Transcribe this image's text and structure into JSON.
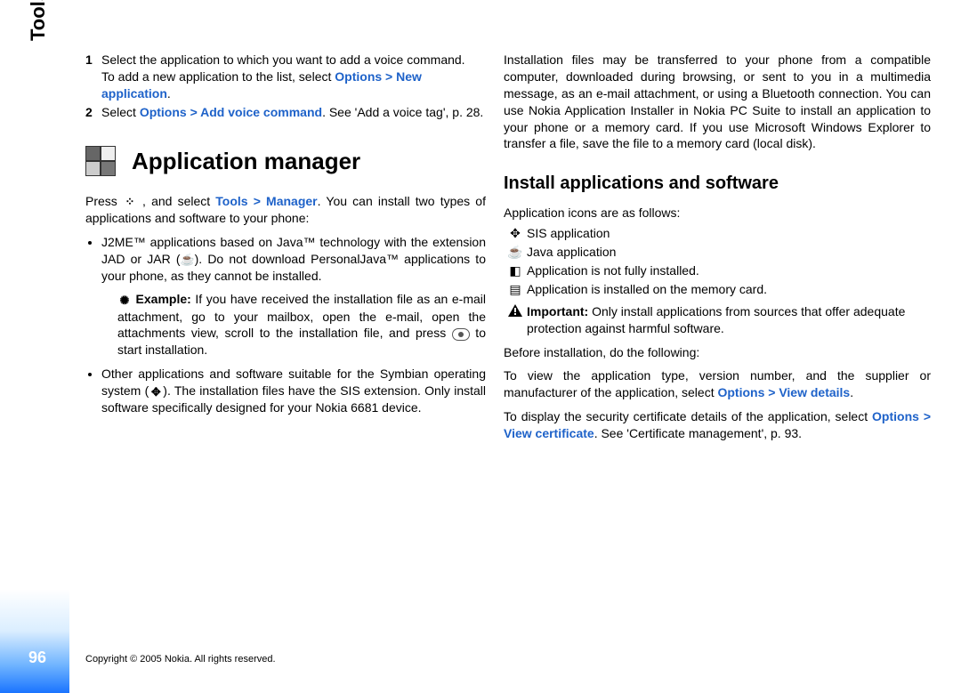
{
  "sideTab": "Tools",
  "pageNumber": "96",
  "copyright": "Copyright © 2005 Nokia. All rights reserved.",
  "step1": {
    "num": "1",
    "text": "Select the application to which you want to add a voice command.",
    "hint_pre": "To add a new application to the list, select ",
    "link1": "Options",
    "gt": " > ",
    "link2": "New application",
    "period": "."
  },
  "step2": {
    "num": "2",
    "pre": "Select ",
    "link1": "Options",
    "gt": " > ",
    "link2": "Add voice command",
    "post": ". See 'Add a voice tag', p. 28."
  },
  "headingMain": "Application manager",
  "press": {
    "pre": "Press ",
    "mid": " , and select ",
    "link1": "Tools",
    "gt": " > ",
    "link2": "Manager",
    "post": ". You can install two types of applications and software to your phone:"
  },
  "bullet1": {
    "pre": "J2ME™ applications based on Java™ technology with the extension JAD or JAR (",
    "post": "). Do not download PersonalJava™ applications to your phone, as they cannot be installed."
  },
  "example": {
    "label": " Example: ",
    "text": "If you have received the installation file as an e-mail attachment, go to your mailbox, open the e-mail, open the attachments view, scroll to the installation file, and press ",
    "post": " to start installation."
  },
  "bullet2": {
    "pre": "Other applications and software suitable for the Symbian operating system (",
    "post": "). The installation files have the SIS extension. Only install software specifically designed for your Nokia 6681 device."
  },
  "rcol": {
    "p1": "Installation files may be transferred to your phone from a compatible computer, downloaded during browsing, or sent to you in a multimedia message, as an e-mail attachment, or using a Bluetooth connection. You can use Nokia Application Installer in Nokia PC Suite to install an application to your phone or a memory card. If you use Microsoft Windows Explorer to transfer a file, save the file to a memory card (local disk).",
    "h2": "Install applications and software",
    "icons_intro": "Application icons are as follows:",
    "i1": "SIS application",
    "i2": "Java application",
    "i3": "Application is not fully installed.",
    "i4": "Application is installed on the memory card.",
    "important_label": "Important:",
    "important_text": " Only install applications from sources that offer adequate protection against harmful software.",
    "before": "Before installation, do the following:",
    "view_details": {
      "pre": "To view the application type, version number, and the supplier or manufacturer of the application, select ",
      "link1": "Options",
      "gt": " > ",
      "link2": "View details",
      "post": "."
    },
    "view_cert": {
      "pre": "To display the security certificate details of the application, select ",
      "link1": "Options",
      "gt": " > ",
      "link2": "View certificate",
      "post": ". See 'Certificate management', p. 93."
    }
  }
}
